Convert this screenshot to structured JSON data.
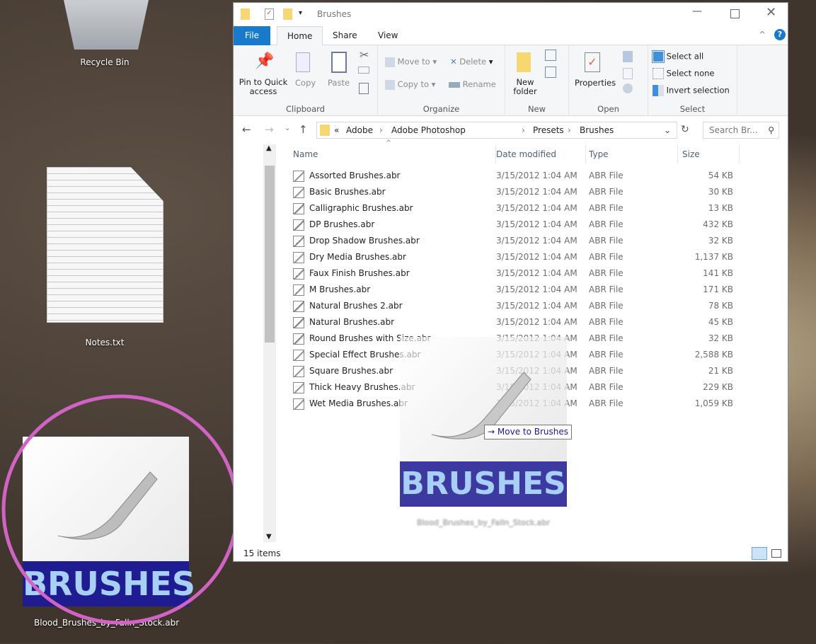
{
  "desktop": {
    "recycle_bin": "Recycle Bin",
    "notes": "Notes.txt",
    "dragged_file": "Blood_Brushes_by_Falln_Stock.abr",
    "thumbnail_text": "BRUSHES"
  },
  "window": {
    "title": "Brushes",
    "tabs": [
      "File",
      "Home",
      "Share",
      "View"
    ],
    "ribbon": {
      "clipboard": {
        "label": "Clipboard",
        "pin": "Pin to Quick access",
        "copy": "Copy",
        "paste": "Paste"
      },
      "organize": {
        "label": "Organize",
        "move_to": "Move to",
        "copy_to": "Copy to",
        "delete": "Delete",
        "rename": "Rename"
      },
      "new": {
        "label": "New",
        "new_folder": "New folder"
      },
      "open": {
        "label": "Open",
        "properties": "Properties"
      },
      "select": {
        "label": "Select",
        "select_all": "Select all",
        "select_none": "Select none",
        "invert": "Invert selection"
      }
    },
    "address": {
      "overflow": "«",
      "crumbs": [
        "Adobe",
        "Adobe Photoshop",
        "Presets",
        "Brushes"
      ],
      "search_placeholder": "Search Br..."
    },
    "columns": {
      "name": "Name",
      "date": "Date modified",
      "type": "Type",
      "size": "Size"
    },
    "files": [
      {
        "name": "Assorted Brushes.abr",
        "date": "3/15/2012 1:04 AM",
        "type": "ABR File",
        "size": "54 KB"
      },
      {
        "name": "Basic Brushes.abr",
        "date": "3/15/2012 1:04 AM",
        "type": "ABR File",
        "size": "30 KB"
      },
      {
        "name": "Calligraphic Brushes.abr",
        "date": "3/15/2012 1:04 AM",
        "type": "ABR File",
        "size": "13 KB"
      },
      {
        "name": "DP Brushes.abr",
        "date": "3/15/2012 1:04 AM",
        "type": "ABR File",
        "size": "432 KB"
      },
      {
        "name": "Drop Shadow Brushes.abr",
        "date": "3/15/2012 1:04 AM",
        "type": "ABR File",
        "size": "32 KB"
      },
      {
        "name": "Dry Media Brushes.abr",
        "date": "3/15/2012 1:04 AM",
        "type": "ABR File",
        "size": "1,137 KB"
      },
      {
        "name": "Faux Finish Brushes.abr",
        "date": "3/15/2012 1:04 AM",
        "type": "ABR File",
        "size": "141 KB"
      },
      {
        "name": "M Brushes.abr",
        "date": "3/15/2012 1:04 AM",
        "type": "ABR File",
        "size": "171 KB"
      },
      {
        "name": "Natural Brushes 2.abr",
        "date": "3/15/2012 1:04 AM",
        "type": "ABR File",
        "size": "78 KB"
      },
      {
        "name": "Natural Brushes.abr",
        "date": "3/15/2012 1:04 AM",
        "type": "ABR File",
        "size": "45 KB"
      },
      {
        "name": "Round Brushes with Size.abr",
        "date": "3/15/2012 1:04 AM",
        "type": "ABR File",
        "size": "32 KB"
      },
      {
        "name": "Special Effect Brushes.abr",
        "date": "3/15/2012 1:04 AM",
        "type": "ABR File",
        "size": "2,588 KB"
      },
      {
        "name": "Square Brushes.abr",
        "date": "3/15/2012 1:04 AM",
        "type": "ABR File",
        "size": "21 KB"
      },
      {
        "name": "Thick Heavy Brushes.abr",
        "date": "3/15/2012 1:04 AM",
        "type": "ABR File",
        "size": "229 KB"
      },
      {
        "name": "Wet Media Brushes.abr",
        "date": "3/15/2012 1:04 AM",
        "type": "ABR File",
        "size": "1,059 KB"
      }
    ],
    "drag_tooltip": "Move to Brushes",
    "status": "15 items"
  },
  "colors": {
    "accent": "#1979ca",
    "highlight_circle": "#d163c4",
    "thumb_band": "#3c3aa0",
    "thumb_text": "#a8cff5"
  }
}
